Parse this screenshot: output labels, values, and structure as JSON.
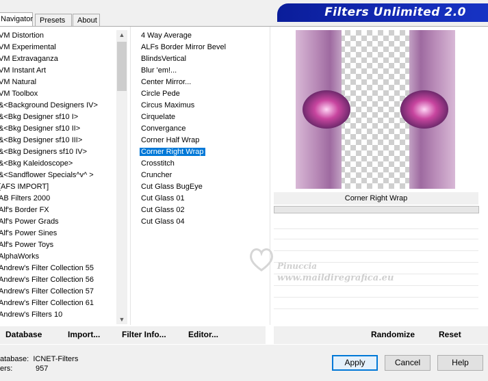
{
  "header": {
    "title": "Filters Unlimited 2.0"
  },
  "tabs": [
    {
      "label": "Navigator",
      "active": true
    },
    {
      "label": "Presets",
      "active": false
    },
    {
      "label": "About",
      "active": false
    }
  ],
  "categories": [
    "VM Distortion",
    "VM Experimental",
    "VM Extravaganza",
    "VM Instant Art",
    "VM Natural",
    "VM Toolbox",
    "&<Background Designers IV>",
    "&<Bkg Designer sf10 I>",
    "&<Bkg Designer sf10 II>",
    "&<Bkg Designer sf10 III>",
    "&<Bkg Designers sf10 IV>",
    "&<Bkg Kaleidoscope>",
    "&<Sandflower Specials^v^ >",
    "[AFS IMPORT]",
    "AB Filters 2000",
    "Alf's Border FX",
    "Alf's Power Grads",
    "Alf's Power Sines",
    "Alf's Power Toys",
    "AlphaWorks",
    "Andrew's Filter Collection 55",
    "Andrew's Filter Collection 56",
    "Andrew's Filter Collection 57",
    "Andrew's Filter Collection 61",
    "Andrew's Filters 10"
  ],
  "filters": [
    "4 Way Average",
    "ALFs Border Mirror Bevel",
    "BlindsVertical",
    "Blur 'em!...",
    "Center Mirror...",
    "Circle Pede",
    "Circus Maximus",
    "Cirquelate",
    "Convergance",
    "Corner Half Wrap",
    "Corner Right Wrap",
    "Crosstitch",
    "Cruncher",
    "Cut Glass  BugEye",
    "Cut Glass 01",
    "Cut Glass 02",
    "Cut Glass 04"
  ],
  "selected_filter": "Corner Right Wrap",
  "preview": {
    "label": "Corner Right Wrap"
  },
  "toolbar": {
    "database": "Database",
    "import": "Import...",
    "filter_info": "Filter Info...",
    "editor": "Editor...",
    "randomize": "Randomize",
    "reset": "Reset"
  },
  "status": {
    "db_key": "atabase:",
    "db_value": "ICNET-Filters",
    "filters_key": "ers:",
    "filters_value": "957"
  },
  "buttons": {
    "apply": "Apply",
    "cancel": "Cancel",
    "help": "Help"
  },
  "watermark": {
    "line1": "Pinuccia",
    "line2": "www.maildiregrafica.eu"
  },
  "colors": {
    "selection": "#0078d7",
    "banner": "#1430b8"
  }
}
